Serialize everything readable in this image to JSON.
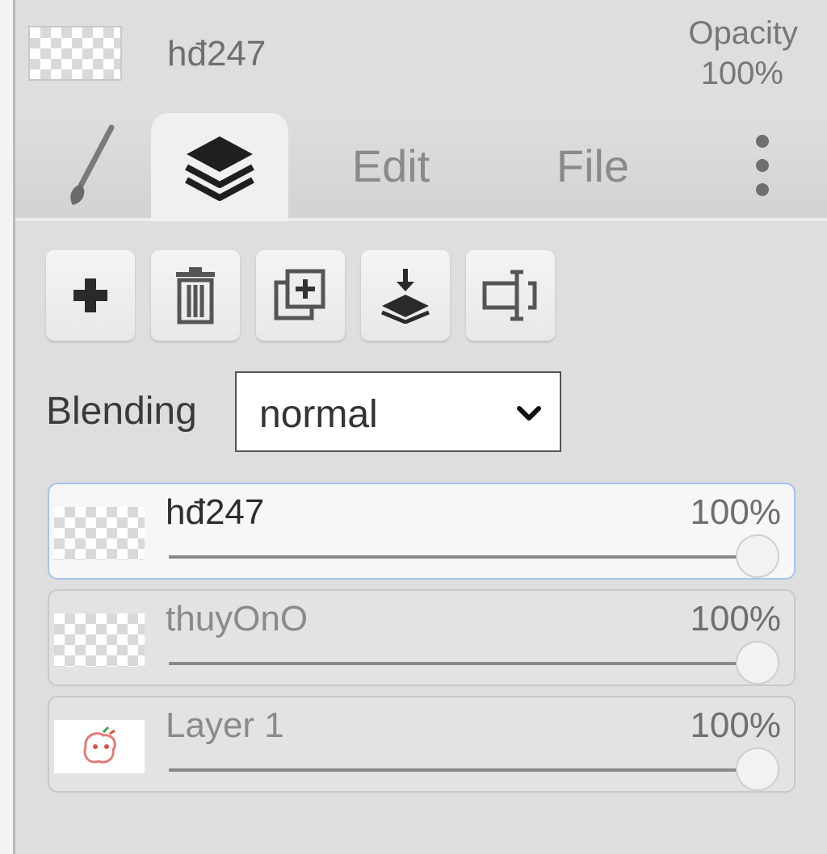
{
  "header": {
    "layer_name": "hđ247",
    "opacity_label": "Opacity",
    "opacity_value": "100%"
  },
  "tabs": [
    {
      "id": "brush",
      "icon": "brush-icon"
    },
    {
      "id": "layers",
      "icon": "layers-icon",
      "active": true
    },
    {
      "id": "edit",
      "label": "Edit"
    },
    {
      "id": "file",
      "label": "File"
    },
    {
      "id": "more",
      "icon": "more-vertical-icon"
    }
  ],
  "toolbar": [
    {
      "icon": "plus-icon"
    },
    {
      "icon": "trash-icon"
    },
    {
      "icon": "duplicate-icon"
    },
    {
      "icon": "merge-down-icon"
    },
    {
      "icon": "rename-icon"
    }
  ],
  "blending": {
    "label": "Blending",
    "value": "normal"
  },
  "layers": [
    {
      "name": "hđ247",
      "opacity": "100%",
      "opacity_value": 1.0,
      "active": true,
      "thumb": "transparent"
    },
    {
      "name": "thuyOnO",
      "opacity": "100%",
      "opacity_value": 1.0,
      "active": false,
      "thumb": "transparent"
    },
    {
      "name": "Layer 1",
      "opacity": "100%",
      "opacity_value": 1.0,
      "active": false,
      "thumb": "drawing"
    }
  ],
  "colors": {
    "active_border": "#a6c2ee",
    "panel_bg": "#dedede"
  }
}
